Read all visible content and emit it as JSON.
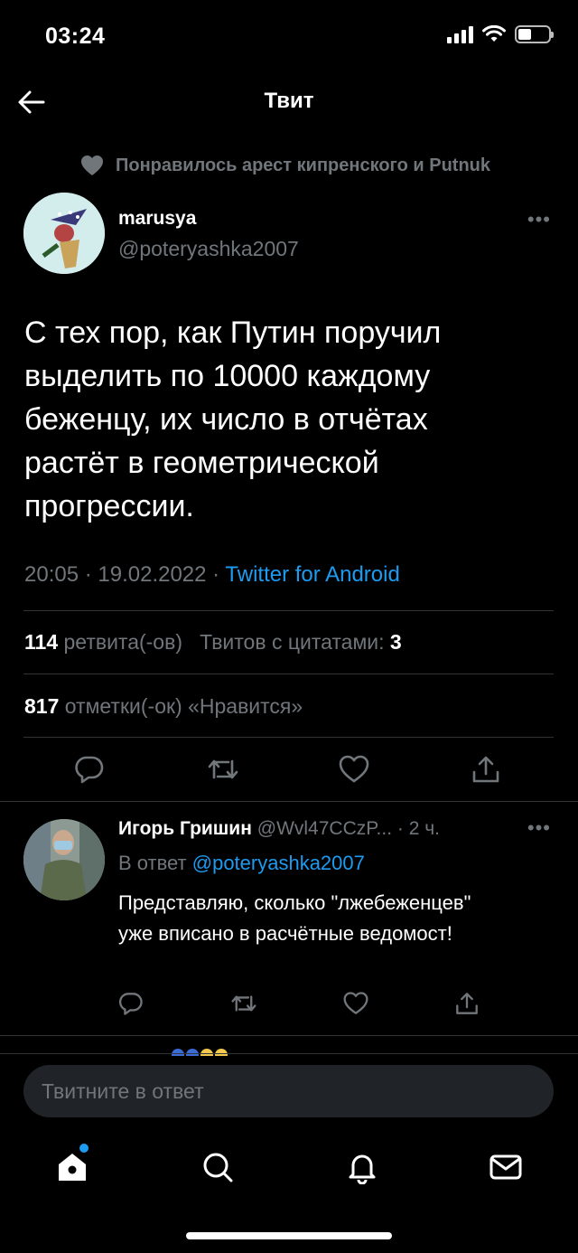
{
  "status_bar": {
    "time": "03:24"
  },
  "header": {
    "title": "Твит"
  },
  "context": {
    "text": "Понравилось арест кипренского и Putnuk"
  },
  "tweet": {
    "author_name": "marusya",
    "author_handle": "@poteryashka2007",
    "text": "С тех пор, как Путин поручил выделить по 10000 каждому беженцу, их число в отчётах растёт в геометрической прогрессии.",
    "timestamp": "20:05 · 19.02.2022 · ",
    "source": "Twitter for Android",
    "retweets_count": "114",
    "retweets_label": "ретвита(-ов)",
    "quotes_label": "Твитов с цитатами:",
    "quotes_count": "3",
    "likes_count": "817",
    "likes_label": "отметки(-ок) «Нравится»"
  },
  "reply": {
    "name": "Игорь Гришин",
    "handle": "@Wvl47CCzP...",
    "time": "· 2 ч.",
    "reply_prefix": "В ответ ",
    "reply_mention": "@poteryashka2007",
    "text": "Представляю, сколько \"лжебеженцев\" уже вписано в расчётные ведомост!"
  },
  "compose": {
    "placeholder": "Твитните в ответ"
  },
  "icons": {
    "back": "back-arrow-icon",
    "reply": "reply-icon",
    "retweet": "retweet-icon",
    "like": "heart-icon",
    "share": "share-icon",
    "home": "home-icon",
    "search": "search-icon",
    "notifications": "bell-icon",
    "messages": "mail-icon"
  },
  "colors": {
    "accent": "#1d9bf0",
    "background": "#000000",
    "muted": "#71767b"
  }
}
